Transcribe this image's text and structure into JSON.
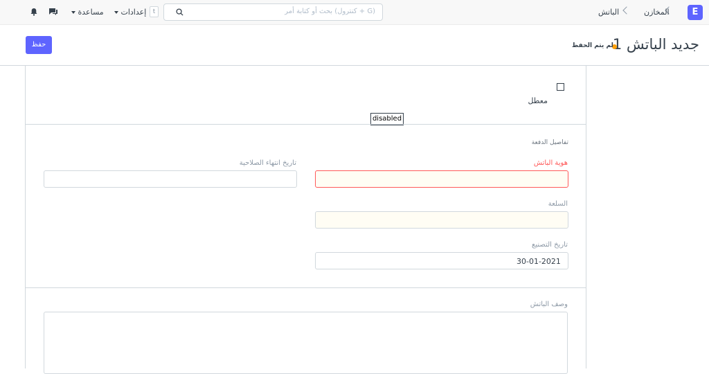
{
  "navbar": {
    "logo_letter": "E",
    "breadcrumbs": [
      "المخازن",
      "الباتش"
    ],
    "search_placeholder": "بحث أو كتابة أمر (كنترول + G)",
    "search_shortcut": "t",
    "settings_label": "إعدادات",
    "help_label": "مساعدة"
  },
  "page_head": {
    "title": "جديد الباتش 1",
    "indicator": "لم يتم الحفظ",
    "indicator_color": "#ffa00a",
    "save_label": "حفظ",
    "accent": "#5e64ff"
  },
  "form": {
    "disabled_label": "معطل",
    "disabled_tooltip": "disabled",
    "section_title": "تفاصيل الدفعة",
    "batch_id_label": "هوية الباتش",
    "batch_id_value": "",
    "expiry_label": "تاريخ انتهاء الصلاحية",
    "expiry_value": "",
    "item_label": "السلعة",
    "item_value": "",
    "manufacturing_label": "تاريخ التصنيع",
    "manufacturing_value": "30-01-2021",
    "description_label": "وصف الباتش"
  }
}
